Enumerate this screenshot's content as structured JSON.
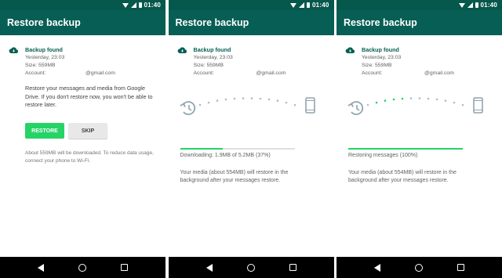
{
  "status_bar": {
    "time": "01:40"
  },
  "app_bar": {
    "title": "Restore backup"
  },
  "backup": {
    "title": "Backup found",
    "date": "Yesterday, 23:03",
    "size": "Size: 559MB",
    "account_label": "Account:",
    "account_value": "@gmail.com"
  },
  "screen1": {
    "description": "Restore your messages and media from Google Drive. If you don't restore now, you won't be able to restore later.",
    "restore_label": "RESTORE",
    "skip_label": "SKIP",
    "note": "About 559MB will be downloaded. To reduce data usage, connect your phone to Wi-Fi."
  },
  "screen2": {
    "progress_text": "Downloading: 1.9MB of 5.2MB (37%)",
    "progress": 0.37,
    "background_note": "Your media (about 554MB) will restore in the background after your messages restore."
  },
  "screen3": {
    "progress_text": "Restoring messages (100%)",
    "progress": 1.0,
    "background_note": "Your media (about 554MB) will restore in the background after your messages restore."
  },
  "icons": {
    "cloud": "cloud-icon",
    "history": "history-icon",
    "phone": "phone-icon"
  },
  "colors": {
    "status_bar": "#06574c",
    "app_bar": "#075e54",
    "accent_green": "#25d366",
    "button_grey": "#e8e8e8"
  }
}
